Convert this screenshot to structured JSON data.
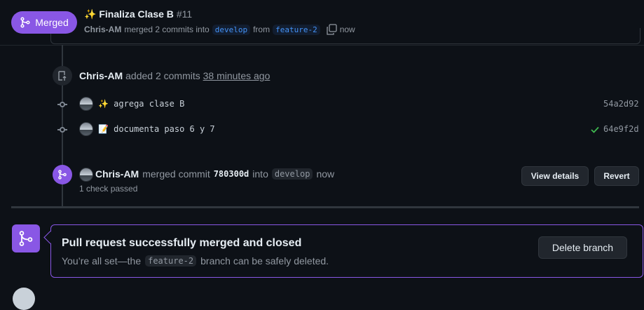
{
  "header": {
    "badge_label": "Merged",
    "title": "✨ Finaliza Clase B",
    "number": "#11",
    "author": "Chris-AM",
    "merged_text": "merged 2 commits into",
    "base_branch": "develop",
    "from_text": "from",
    "head_branch": "feature-2",
    "time": "now"
  },
  "timeline": {
    "commits_event": {
      "author": "Chris-AM",
      "action": "added 2 commits",
      "time": "38 minutes ago"
    },
    "commits": [
      {
        "message": "✨ agrega clase B",
        "sha": "54a2d92",
        "check": false
      },
      {
        "message": "📝 documenta paso 6 y 7",
        "sha": "64e9f2d",
        "check": true
      }
    ],
    "merge_event": {
      "author": "Chris-AM",
      "action": "merged commit",
      "commit": "780300d",
      "into_text": "into",
      "branch": "develop",
      "time": "now",
      "checks": "1 check passed",
      "view_details_label": "View details",
      "revert_label": "Revert"
    }
  },
  "merge_box": {
    "title": "Pull request successfully merged and closed",
    "desc_before": "You’re all set—the",
    "branch": "feature-2",
    "desc_after": "branch can be safely deleted.",
    "delete_label": "Delete branch"
  },
  "colors": {
    "accent_purple": "#8957e5",
    "bg": "#0d1117",
    "success_green": "#3fb950"
  }
}
